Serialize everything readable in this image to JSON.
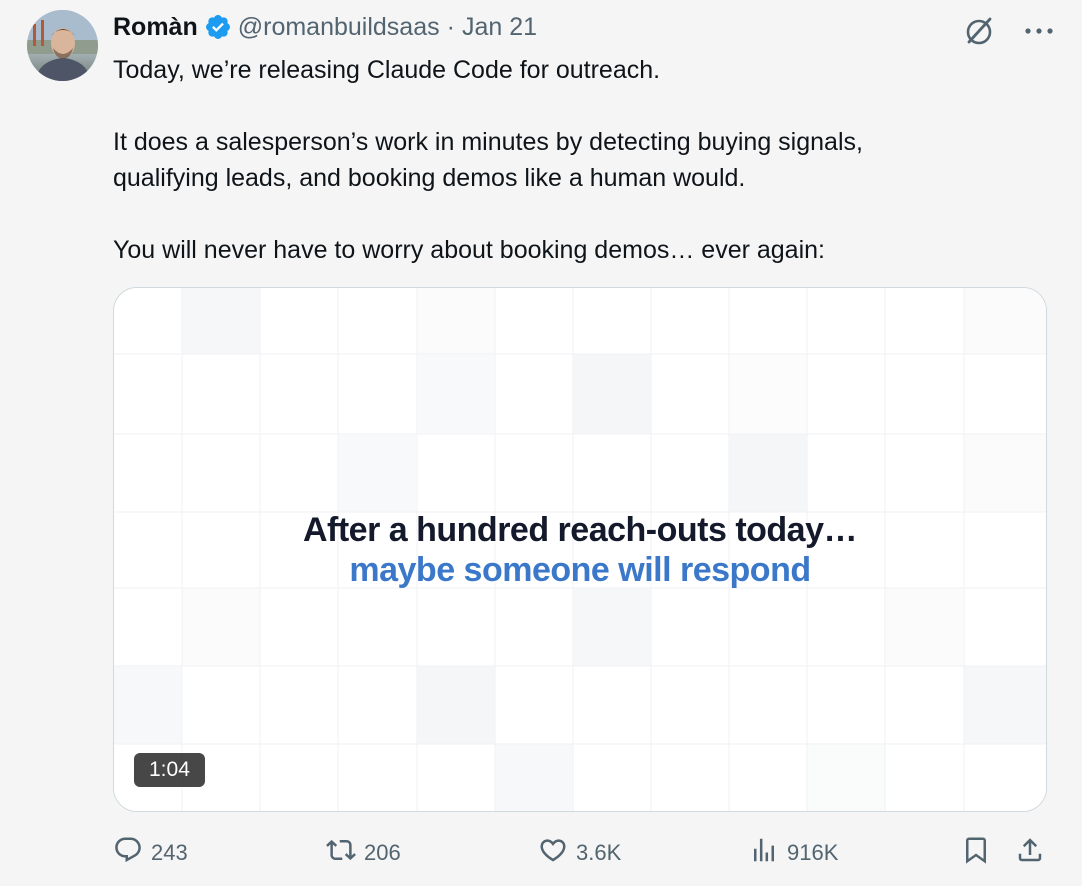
{
  "author": {
    "display_name": "Romàn",
    "handle": "@romanbuildsaas",
    "separator": "·",
    "date": "Jan 21"
  },
  "tweet": {
    "paragraphs": [
      "Today, we’re releasing Claude Code for outreach.",
      "It does a salesperson’s work in minutes by detecting buying signals,\nqualifying leads, and booking demos like a human would.",
      "You will never have to worry about booking demos… ever again:"
    ]
  },
  "media": {
    "caption_line1": "After a hundred reach-outs today…",
    "caption_line2": "maybe someone will respond",
    "duration": "1:04"
  },
  "metrics": {
    "replies": "243",
    "reposts": "206",
    "likes": "3.6K",
    "views": "916K"
  },
  "icons": {
    "verified": "verified-badge-icon",
    "grok": "grok-icon",
    "more": "more-icon",
    "reply": "reply-icon",
    "repost": "repost-icon",
    "like": "heart-icon",
    "views": "views-icon",
    "bookmark": "bookmark-icon",
    "share": "share-icon"
  },
  "colors": {
    "verified": "#1d9bf0",
    "text": "#0f1419",
    "secondary": "#536471",
    "caption_dark": "#141a2b",
    "caption_blue": "#3b78c9"
  }
}
